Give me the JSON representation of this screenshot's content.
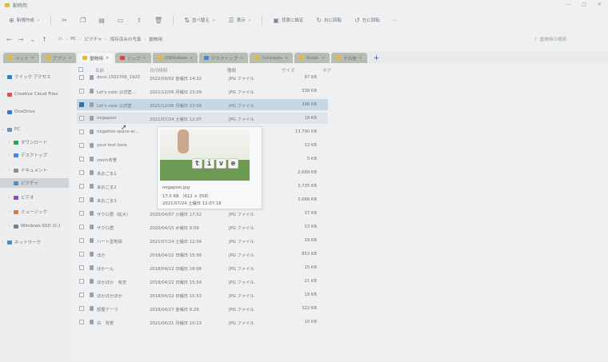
{
  "window": {
    "title": "動物用"
  },
  "toolbar": {
    "new_label": "新規作成",
    "sort_label": "並べ替え",
    "view_label": "表示",
    "wallpaper_label": "背景に設定",
    "rotate_right_label": "右に回転",
    "rotate_left_label": "左に回転",
    "more_label": "..."
  },
  "address": {
    "crumbs": [
      "PC",
      "ピクチャ",
      "保存済みの写真",
      "動物用"
    ],
    "search_placeholder": "動物用の検索"
  },
  "tabs": [
    {
      "label": "ペット"
    },
    {
      "label": "アプリ"
    },
    {
      "label": "動物用"
    },
    {
      "label": "ジップ"
    },
    {
      "label": "DWVideos"
    },
    {
      "label": "デスクトップ"
    },
    {
      "label": "Concepts"
    },
    {
      "label": "Excel"
    },
    {
      "label": "その他"
    }
  ],
  "sidebar": {
    "items": [
      {
        "label": "クイック アクセス",
        "icon": "star-icon",
        "color": "#3a78c8"
      },
      {
        "label": "Creative Cloud Files",
        "icon": "cloud-icon",
        "color": "#d9534f"
      },
      {
        "label": "OneDrive",
        "icon": "cloud-icon",
        "color": "#3a78c8"
      },
      {
        "label": "PC",
        "icon": "pc-icon",
        "color": "#6b8fb8"
      },
      {
        "label": "ダウンロード",
        "icon": "download-icon",
        "color": "#3a9a5a"
      },
      {
        "label": "デスクトップ",
        "icon": "desktop-icon",
        "color": "#4a8ac8"
      },
      {
        "label": "ドキュメント",
        "icon": "document-icon",
        "color": "#8a8f94"
      },
      {
        "label": "ピクチャ",
        "icon": "picture-icon",
        "color": "#4a90c8"
      },
      {
        "label": "ビデオ",
        "icon": "video-icon",
        "color": "#8a4ac8"
      },
      {
        "label": "ミュージック",
        "icon": "music-icon",
        "color": "#d97a3a"
      },
      {
        "label": "Windows-SSD (C:)",
        "icon": "drive-icon",
        "color": "#7c8186"
      },
      {
        "label": "ネットワーク",
        "icon": "network-icon",
        "color": "#4a8ac8"
      }
    ]
  },
  "columns": {
    "name": "名前",
    "date": "日付時刻",
    "type": "種類",
    "size": "サイズ",
    "tags": "タグ"
  },
  "files": [
    {
      "name": "dsce-1502706_1920",
      "date": "2022/09/02 金曜日 14:32",
      "type": "JPG ファイル",
      "size": "97 KB"
    },
    {
      "name": "Let's note 公式壁...",
      "date": "2021/12/06 月曜日 23:09",
      "type": "JPG ファイル",
      "size": "338 KB"
    },
    {
      "name": "Let's note 公式壁...",
      "date": "2021/12/06 月曜日 23:09",
      "type": "JPG ファイル",
      "size": "386 KB"
    },
    {
      "name": "negaposi",
      "date": "2021/07/24 土曜日 12:07",
      "type": "JPG ファイル",
      "size": "18 KB"
    },
    {
      "name": "negative-space-ar...",
      "date": "",
      "type": "",
      "size": "13,790 KB"
    },
    {
      "name": "your text here",
      "date": "",
      "type": "",
      "size": "12 KB"
    },
    {
      "name": "zoom背景",
      "date": "",
      "type": "",
      "size": "5 KB"
    },
    {
      "name": "あおごま1",
      "date": "",
      "type": "",
      "size": "2,689 KB"
    },
    {
      "name": "あおごま2",
      "date": "",
      "type": "",
      "size": "3,735 KB"
    },
    {
      "name": "あおごま3",
      "date": "",
      "type": "",
      "size": "3,666 KB"
    },
    {
      "name": "ザクロ君（拡大）",
      "date": "2020/04/07 火曜日 17:52",
      "type": "JPG ファイル",
      "size": "37 KB"
    },
    {
      "name": "ザクロ君",
      "date": "2020/04/15 水曜日 0:09",
      "type": "JPG ファイル",
      "size": "53 KB"
    },
    {
      "name": "ハート型地球",
      "date": "2021/07/24 土曜日 12:04",
      "type": "JPG ファイル",
      "size": "29 KB"
    },
    {
      "name": "ほか",
      "date": "2018/04/22 日曜日 15:56",
      "type": "JPG ファイル",
      "size": "853 KB"
    },
    {
      "name": "ほかーん",
      "date": "2018/04/22 日曜日 16:08",
      "type": "JPG ファイル",
      "size": "15 KB"
    },
    {
      "name": "ほかほか　有吉",
      "date": "2018/04/22 日曜日 15:54",
      "type": "JPG ファイル",
      "size": "21 KB"
    },
    {
      "name": "ほかほかほか",
      "date": "2018/04/22 日曜日 15:53",
      "type": "JPG ファイル",
      "size": "19 KB"
    },
    {
      "name": "部屋テーマ",
      "date": "2018/04/27 金曜日 0:28",
      "type": "JPG ファイル",
      "size": "322 KB"
    },
    {
      "name": "白　背景",
      "date": "2021/06/21 月曜日 10:13",
      "type": "JPG ファイル",
      "size": "10 KB"
    }
  ],
  "tooltip": {
    "dice_letters": [
      "t",
      "i",
      "v",
      "e"
    ],
    "filename": "negaposi.jpg",
    "size_dims": "17.0 KB  （612 × 358）",
    "date": "2021/07/24 土曜日 12:07:18"
  }
}
